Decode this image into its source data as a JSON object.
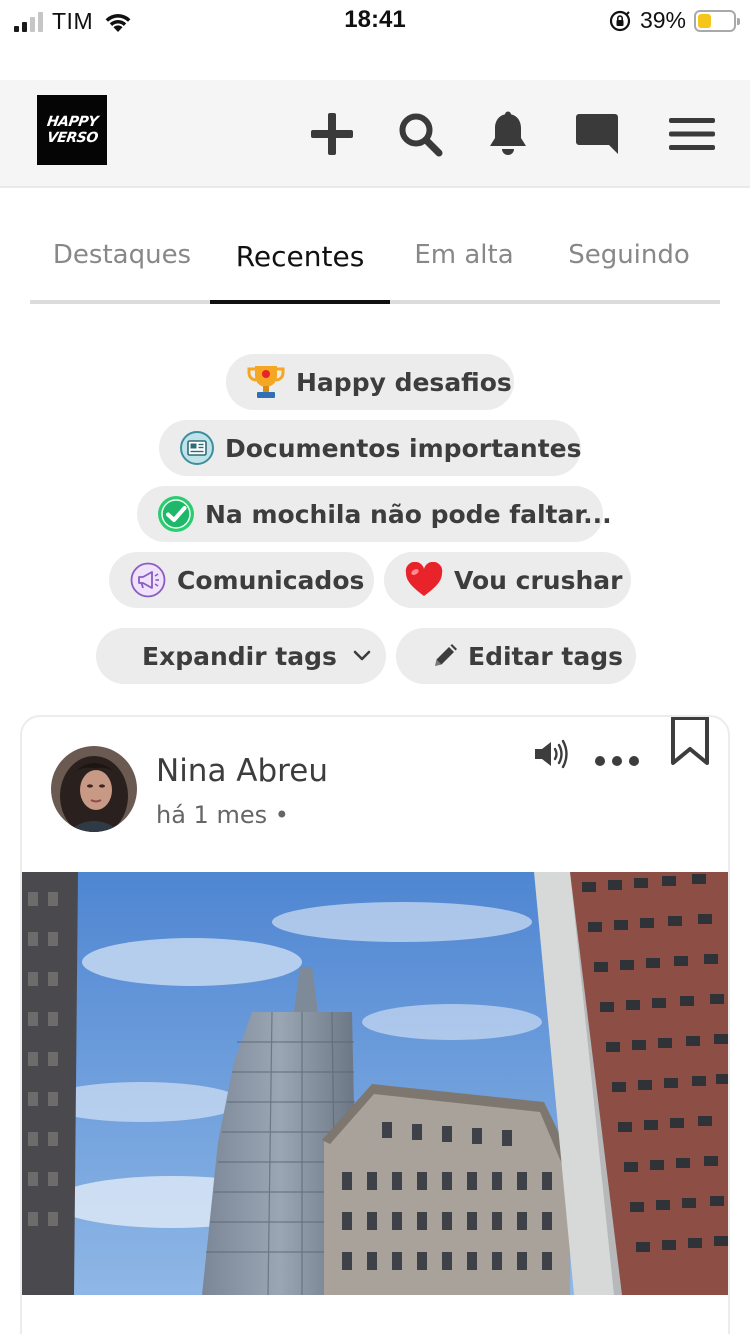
{
  "status_bar": {
    "carrier": "TIM",
    "time": "18:41",
    "battery_percent": "39%",
    "battery_level": 0.39,
    "battery_color": "#f6c51b"
  },
  "header": {
    "logo_line1": "HAPPY",
    "logo_line2": "VERSO",
    "icons": [
      "plus-icon",
      "search-icon",
      "bell-icon",
      "chat-bubble-icon",
      "hamburger-menu-icon"
    ]
  },
  "tabs": [
    {
      "label": "Destaques",
      "active": false
    },
    {
      "label": "Recentes",
      "active": true
    },
    {
      "label": "Em alta",
      "active": false
    },
    {
      "label": "Seguindo",
      "active": false
    }
  ],
  "tags": [
    {
      "label": "Happy desafios",
      "icon": "trophy-icon"
    },
    {
      "label": "Documentos importantes",
      "icon": "newspaper-icon"
    },
    {
      "label": "Na mochila não pode faltar...",
      "icon": "check-icon"
    },
    {
      "label": "Comunicados",
      "icon": "megaphone-icon"
    },
    {
      "label": "Vou crushar",
      "icon": "heart-icon"
    }
  ],
  "tag_actions": {
    "expand_label": "Expandir tags",
    "edit_label": "Editar tags"
  },
  "post": {
    "author": "Nina Abreu",
    "time": "há 1 mes •",
    "icons": [
      "speaker-icon",
      "more-options-icon",
      "bookmark-icon"
    ]
  },
  "colors": {
    "header_bg": "#f5f5f5",
    "tag_bg": "#ececec",
    "active_tab": "#111111",
    "inactive_tab": "#888888",
    "check_green": "#2ecc71",
    "heart_red": "#e8232a"
  }
}
